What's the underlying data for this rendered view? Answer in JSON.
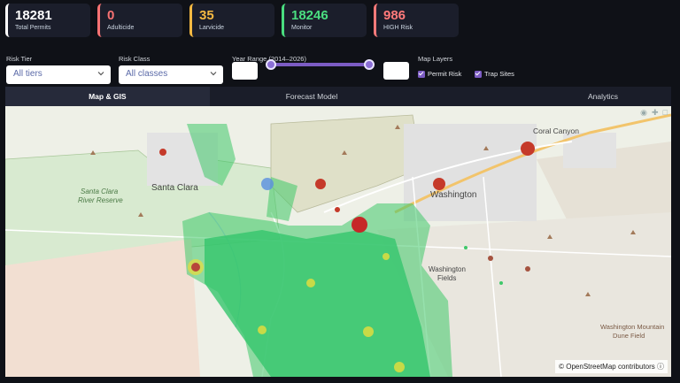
{
  "kpis": [
    {
      "value": "18281",
      "label": "Total Permits",
      "color": "#ffffff"
    },
    {
      "value": "0",
      "label": "Adulticide",
      "color": "#f97373"
    },
    {
      "value": "35",
      "label": "Larvicide",
      "color": "#f5b942"
    },
    {
      "value": "18246",
      "label": "Monitor",
      "color": "#4ade80"
    },
    {
      "value": "986",
      "label": "HIGH Risk",
      "color": "#ff7a7a"
    }
  ],
  "filters": {
    "risk_tier": {
      "label": "Risk Tier",
      "value": "All tiers"
    },
    "risk_class": {
      "label": "Risk Class",
      "value": "All classes"
    },
    "year_range": {
      "label": "Year Range (2014–2026)"
    },
    "map_layers": {
      "label": "Map Layers",
      "permit_risk": "Permit Risk",
      "trap_sites": "Trap Sites"
    }
  },
  "tabs": [
    "Map & GIS",
    "Forecast Model",
    "Analytics"
  ],
  "map": {
    "attribution": "© OpenStreetMap contributors",
    "places": {
      "santa_clara": "Santa Clara",
      "reserve1": "Santa Clara",
      "reserve2": "River Reserve",
      "washington": "Washington",
      "washington_fields1": "Washington",
      "washington_fields2": "Fields",
      "coral_canyon": "Coral Canyon",
      "mountain1": "Washington Mountain",
      "mountain2": "Dune Field"
    }
  }
}
